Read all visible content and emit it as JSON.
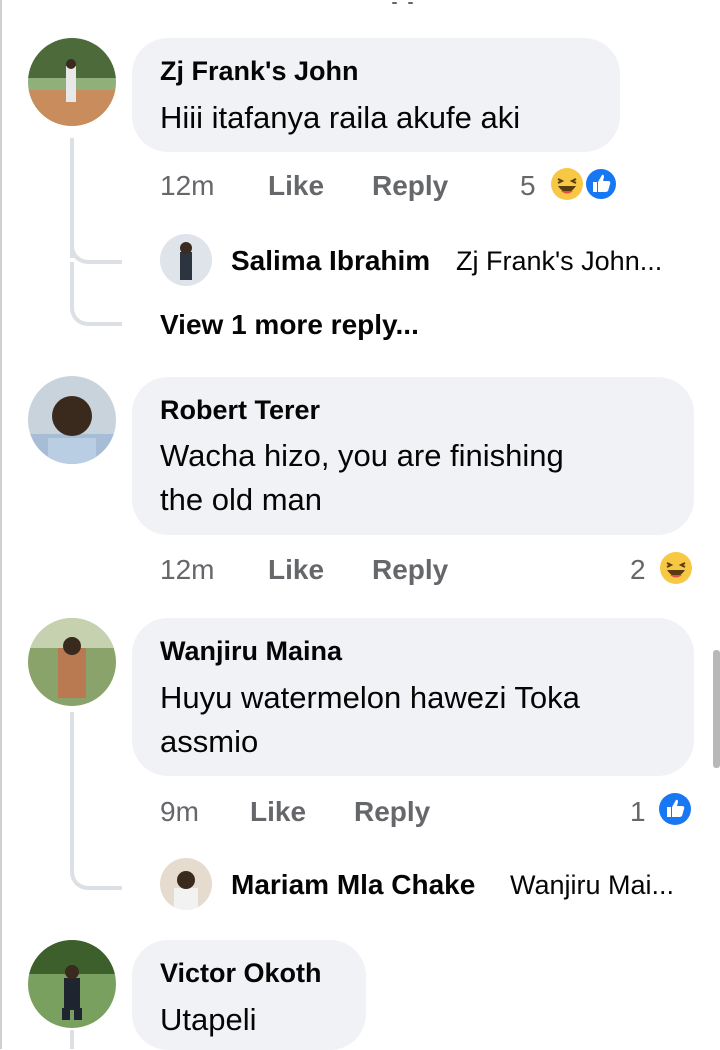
{
  "comments": [
    {
      "author": "Zj Frank's John",
      "text_lines": [
        "Hiii itafanya raila akufe aki"
      ],
      "time": "12m",
      "like_label": "Like",
      "reply_label": "Reply",
      "reaction_count": "5",
      "reactions": [
        "haha-icon",
        "like-icon"
      ],
      "reply_preview": {
        "author": "Salima Ibrahim",
        "snippet": "Zj Frank's John..."
      },
      "view_more": "View 1 more reply..."
    },
    {
      "author": "Robert Terer",
      "text_lines": [
        "Wacha hizo, you are finishing",
        "the old man"
      ],
      "time": "12m",
      "like_label": "Like",
      "reply_label": "Reply",
      "reaction_count": "2",
      "reactions": [
        "haha-icon"
      ]
    },
    {
      "author": "Wanjiru Maina",
      "text_lines": [
        "Huyu watermelon hawezi Toka",
        "assmio"
      ],
      "time": "9m",
      "like_label": "Like",
      "reply_label": "Reply",
      "reaction_count": "1",
      "reactions": [
        "like-icon"
      ],
      "reply_preview": {
        "author": "Mariam Mla Chake",
        "snippet": "Wanjiru Mai..."
      }
    },
    {
      "author": "Victor Okoth",
      "text_lines": [
        "Utapeli"
      ]
    }
  ],
  "colors": {
    "bubble": "#f0f2f5",
    "meta_text": "#65676b",
    "like_blue": "#1877f2",
    "haha_yellow": "#f7c844"
  }
}
